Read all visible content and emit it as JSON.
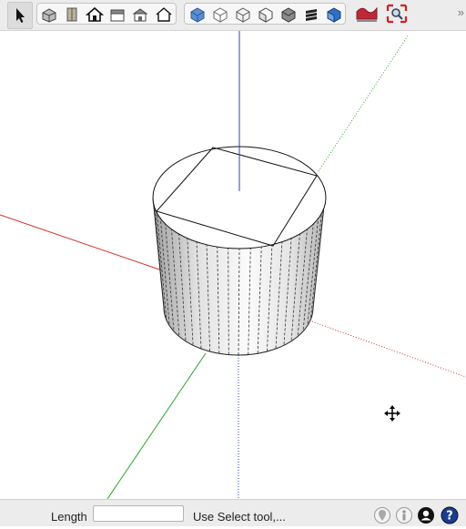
{
  "toolbar": {
    "select_tool": {
      "icon": "select-arrow-icon"
    },
    "view_buttons": [
      {
        "icon": "iso-view-icon"
      },
      {
        "icon": "top-view-icon"
      },
      {
        "icon": "front-view-icon"
      },
      {
        "icon": "right-view-icon"
      },
      {
        "icon": "back-view-icon"
      },
      {
        "icon": "left-view-icon"
      }
    ],
    "style_buttons": [
      {
        "icon": "xray-style-icon"
      },
      {
        "icon": "wireframe-style-icon"
      },
      {
        "icon": "hidden-line-style-icon"
      },
      {
        "icon": "shaded-style-icon"
      },
      {
        "icon": "shaded-textures-style-icon"
      },
      {
        "icon": "monochrome-style-icon"
      },
      {
        "icon": "back-edges-style-icon"
      }
    ],
    "extra_buttons": [
      {
        "icon": "sandbox-terrain-icon"
      },
      {
        "icon": "zoom-extents-icon"
      }
    ],
    "overflow": "»"
  },
  "viewport": {
    "axis_colors": {
      "red": "#d03030",
      "green": "#2aa32a",
      "blue": "#2b3fc0"
    }
  },
  "status_bar": {
    "length_label": "Length",
    "length_value": "",
    "hint": "Use Select tool,...",
    "icons": [
      "geo-location-icon",
      "credits-icon",
      "user-account-icon",
      "help-icon"
    ]
  }
}
